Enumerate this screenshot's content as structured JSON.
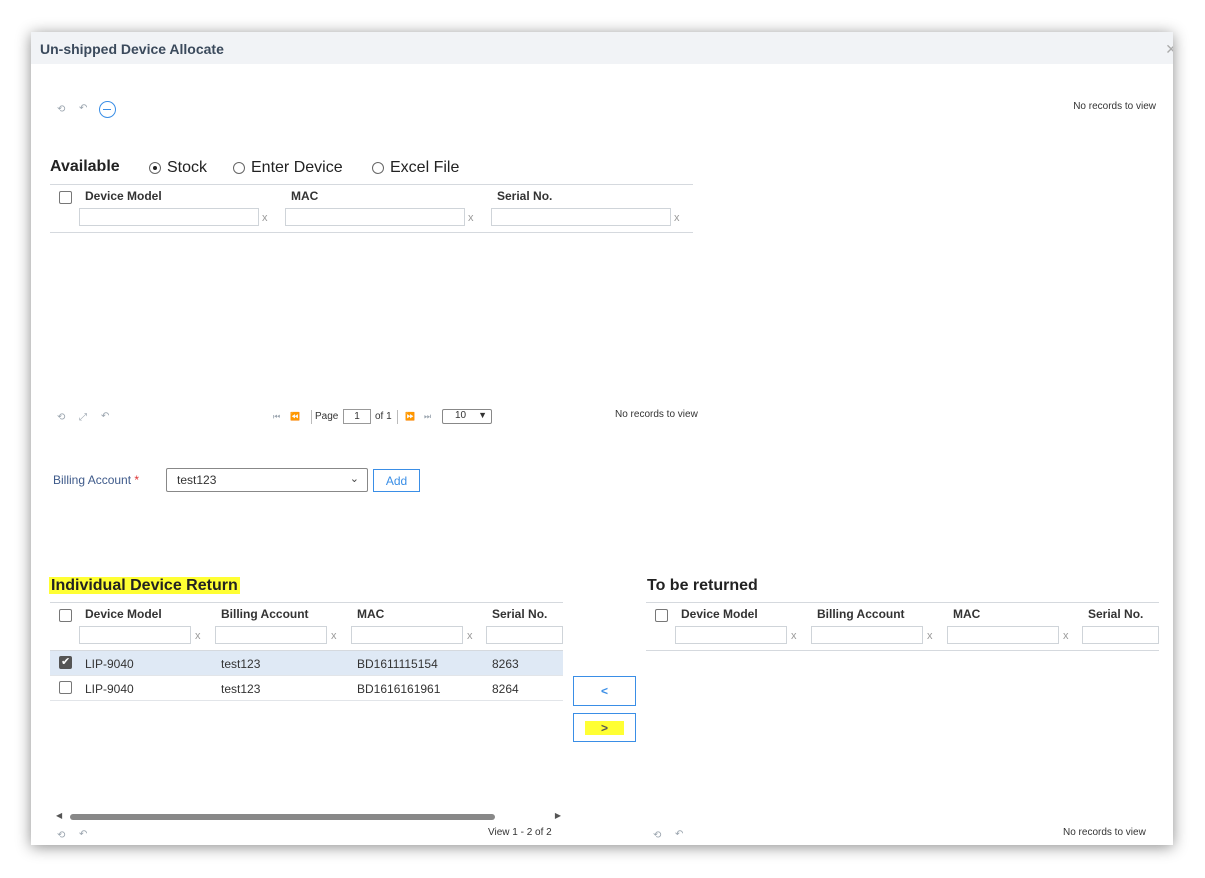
{
  "dialog": {
    "title": "Un-shipped Device Allocate",
    "close_icon": "close-icon"
  },
  "top_toolbar": {
    "icons": [
      "refresh-icon",
      "undo-icon",
      "minus-circle-icon"
    ],
    "records_text": "No records to view"
  },
  "available": {
    "label": "Available",
    "options": [
      {
        "label": "Stock",
        "selected": true
      },
      {
        "label": "Enter Device",
        "selected": false
      },
      {
        "label": "Excel File",
        "selected": false
      }
    ],
    "columns": [
      "Device Model",
      "MAC",
      "Serial No."
    ],
    "clear": "x",
    "pager": {
      "page_label": "Page",
      "page": "1",
      "of_label": "of 1",
      "rows_per_page": "10",
      "records_text": "No records to view"
    }
  },
  "billing": {
    "label": "Billing Account",
    "required_mark": "*",
    "value": "test123",
    "add_label": "Add"
  },
  "individual_return": {
    "title": "Individual Device Return",
    "columns": [
      "Device Model",
      "Billing Account",
      "MAC",
      "Serial No."
    ],
    "clear": "x",
    "rows": [
      {
        "checked": true,
        "model": "LIP-9040",
        "account": "test123",
        "mac": "BD1611115154",
        "serial": "8263"
      },
      {
        "checked": false,
        "model": "LIP-9040",
        "account": "test123",
        "mac": "BD1616161961",
        "serial": "8264"
      }
    ],
    "view_text": "View 1 - 2 of 2"
  },
  "transfer": {
    "left_label": "<",
    "right_label": ">"
  },
  "to_be_returned": {
    "title": "To be returned",
    "columns": [
      "Device Model",
      "Billing Account",
      "MAC",
      "Serial No."
    ],
    "clear": "x",
    "records_text": "No records to view"
  },
  "colors": {
    "accent": "#3a8ee6",
    "highlight": "#ffff33",
    "selected_row": "#dfe9f5"
  }
}
